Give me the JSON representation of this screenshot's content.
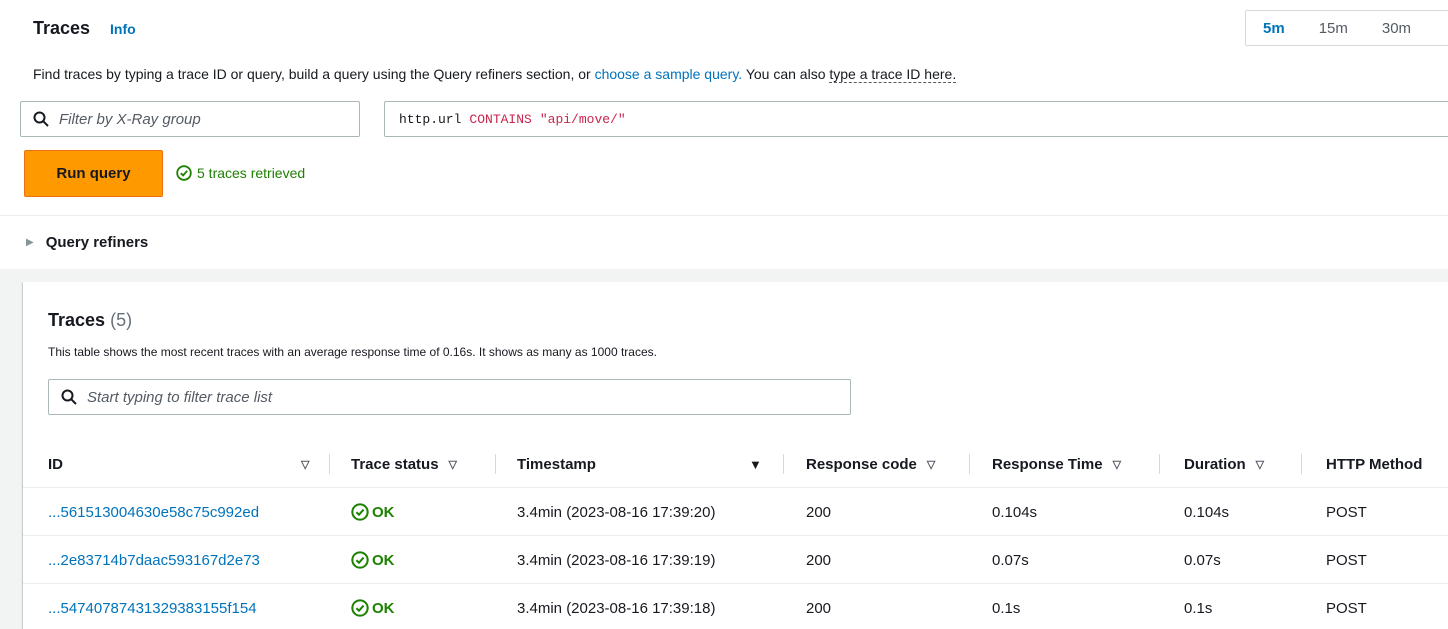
{
  "header": {
    "title": "Traces",
    "info": "Info"
  },
  "time_range": {
    "options": [
      "5m",
      "15m",
      "30m"
    ],
    "selected": "5m"
  },
  "description": {
    "text_1": "Find traces by typing a trace ID or query, build a query using the Query refiners section, or ",
    "sample_link": "choose a sample query.",
    "text_2": " You can also ",
    "trace_id_link": "type a trace ID here."
  },
  "group_filter": {
    "placeholder": "Filter by X-Ray group"
  },
  "query": {
    "field": "http.url",
    "operator": "CONTAINS",
    "value": "\"api/move/\""
  },
  "run_query_label": "Run query",
  "retrieved_status": "5 traces retrieved",
  "refiners_label": "Query refiners",
  "table": {
    "title": "Traces",
    "count": "(5)",
    "description": "This table shows the most recent traces with an average response time of 0.16s. It shows as many as 1000 traces.",
    "filter_placeholder": "Start typing to filter trace list",
    "columns": {
      "id": "ID",
      "status": "Trace status",
      "timestamp": "Timestamp",
      "response_code": "Response code",
      "response_time": "Response Time",
      "duration": "Duration",
      "http_method": "HTTP Method"
    },
    "rows": [
      {
        "id": "...561513004630e58c75c992ed",
        "status": "OK",
        "timestamp": "3.4min (2023-08-16 17:39:20)",
        "response_code": "200",
        "response_time": "0.104s",
        "duration": "0.104s",
        "method": "POST"
      },
      {
        "id": "...2e83714b7daac593167d2e73",
        "status": "OK",
        "timestamp": "3.4min (2023-08-16 17:39:19)",
        "response_code": "200",
        "response_time": "0.07s",
        "duration": "0.07s",
        "method": "POST"
      },
      {
        "id": "...54740787431329383155f154",
        "status": "OK",
        "timestamp": "3.4min (2023-08-16 17:39:18)",
        "response_code": "200",
        "response_time": "0.1s",
        "duration": "0.1s",
        "method": "POST"
      }
    ]
  },
  "colors": {
    "accent": "#0073bb",
    "primary_button": "#ff9900",
    "success": "#1d8102"
  }
}
